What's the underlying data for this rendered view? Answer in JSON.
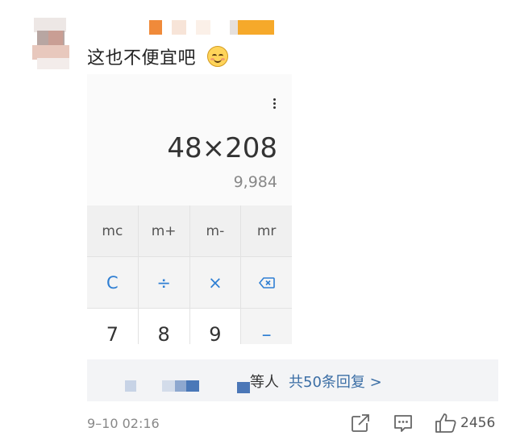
{
  "comment": {
    "text": "这也不便宜吧",
    "emoji": "smiling-face-icon"
  },
  "calculator": {
    "expression": "48×208",
    "result": "9,984",
    "memory_keys": [
      "mc",
      "m+",
      "m-",
      "mr"
    ],
    "operator_keys": [
      "C",
      "÷",
      "×",
      "backspace-icon"
    ],
    "number_keys": [
      "7",
      "8",
      "9",
      "–"
    ],
    "accent_color": "#2f7fd3"
  },
  "replies": {
    "label_fragment": "等人",
    "link_text": "共50条回复 >"
  },
  "footer": {
    "timestamp": "9–10 02:16",
    "like_count": "2456"
  }
}
